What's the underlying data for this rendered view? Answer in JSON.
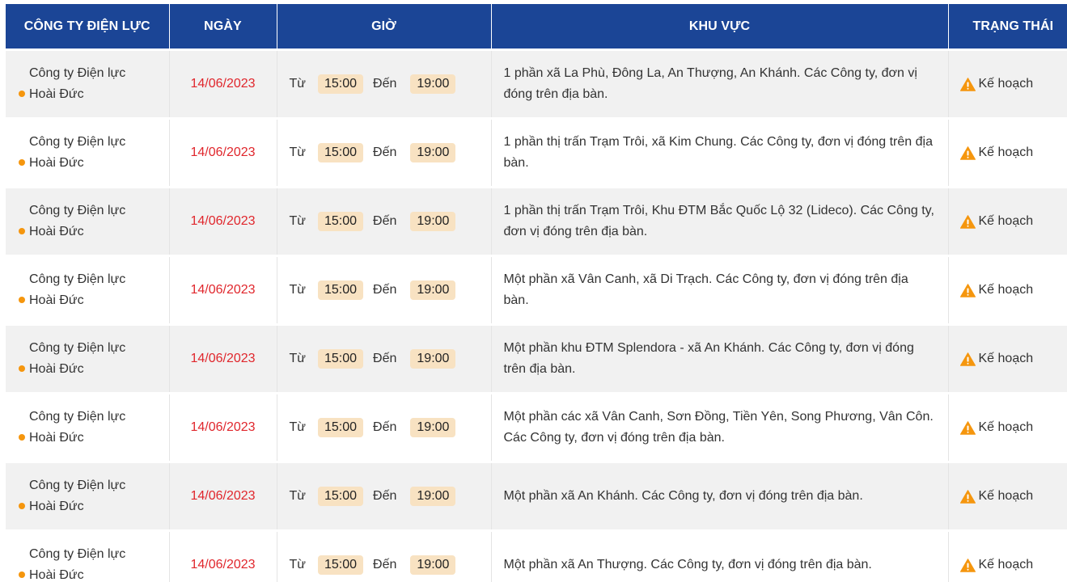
{
  "headers": {
    "company": "CÔNG TY ĐIỆN LỰC",
    "date": "NGÀY",
    "time": "GIỜ",
    "area": "KHU VỰC",
    "status": "TRẠNG THÁI"
  },
  "labels": {
    "from": "Từ",
    "to": "Đến"
  },
  "colors": {
    "header_bg": "#1b4596",
    "date_red": "#e0262c",
    "dot_orange": "#f5960e",
    "pill_bg": "#f8e2c2",
    "warn_orange": "#f5960e"
  },
  "icons": {
    "company_marker": "orange-dot-icon",
    "status": "warning-triangle-icon"
  },
  "rows": [
    {
      "company_line1": "Công ty Điện lực",
      "company_line2": "Hoài Đức",
      "date": "14/06/2023",
      "start": "15:00",
      "end": "19:00",
      "area": "1 phần xã La Phù, Đông La, An Thượng, An Khánh. Các Công ty, đơn vị đóng trên địa bàn.",
      "status": "Kế hoạch"
    },
    {
      "company_line1": "Công ty Điện lực",
      "company_line2": "Hoài Đức",
      "date": "14/06/2023",
      "start": "15:00",
      "end": "19:00",
      "area": "1 phần thị trấn Trạm Trôi, xã Kim Chung. Các Công ty, đơn vị đóng trên địa bàn.",
      "status": "Kế hoạch"
    },
    {
      "company_line1": "Công ty Điện lực",
      "company_line2": "Hoài Đức",
      "date": "14/06/2023",
      "start": "15:00",
      "end": "19:00",
      "area": "1 phần thị trấn Trạm Trôi, Khu ĐTM Bắc Quốc Lộ 32 (Lideco). Các Công ty, đơn vị đóng trên địa bàn.",
      "status": "Kế hoạch"
    },
    {
      "company_line1": "Công ty Điện lực",
      "company_line2": "Hoài Đức",
      "date": "14/06/2023",
      "start": "15:00",
      "end": "19:00",
      "area": "Một phần xã Vân Canh, xã Di Trạch. Các Công ty, đơn vị đóng trên địa bàn.",
      "status": "Kế hoạch"
    },
    {
      "company_line1": "Công ty Điện lực",
      "company_line2": "Hoài Đức",
      "date": "14/06/2023",
      "start": "15:00",
      "end": "19:00",
      "area": "Một phần khu ĐTM Splendora - xã An Khánh. Các Công ty, đơn vị đóng trên địa bàn.",
      "status": "Kế hoạch"
    },
    {
      "company_line1": "Công ty Điện lực",
      "company_line2": "Hoài Đức",
      "date": "14/06/2023",
      "start": "15:00",
      "end": "19:00",
      "area": "Một phần các xã Vân Canh, Sơn Đồng, Tiền Yên, Song Phương, Vân Côn. Các Công ty, đơn vị đóng trên địa bàn.",
      "status": "Kế hoạch"
    },
    {
      "company_line1": "Công ty Điện lực",
      "company_line2": "Hoài Đức",
      "date": "14/06/2023",
      "start": "15:00",
      "end": "19:00",
      "area": "Một phần xã An Khánh. Các Công ty, đơn vị đóng trên địa bàn.",
      "status": "Kế hoạch"
    },
    {
      "company_line1": "Công ty Điện lực",
      "company_line2": "Hoài Đức",
      "date": "14/06/2023",
      "start": "15:00",
      "end": "19:00",
      "area": "Một phần xã An Thượng. Các Công ty, đơn vị đóng trên địa bàn.",
      "status": "Kế hoạch"
    }
  ]
}
